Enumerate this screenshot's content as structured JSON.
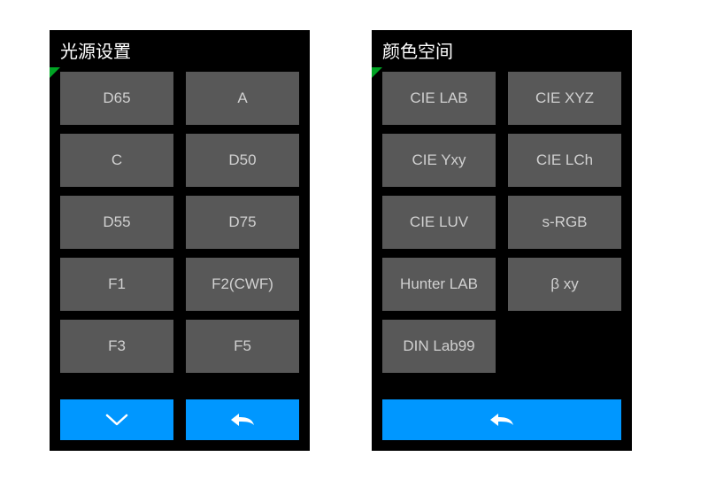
{
  "colors": {
    "accent": "#0097ff",
    "cell_bg": "#585858",
    "panel_bg": "#000000",
    "indicator": "#00a424"
  },
  "panels": {
    "left": {
      "title": "光源设置",
      "items": [
        "D65",
        "A",
        "C",
        "D50",
        "D55",
        "D75",
        "F1",
        "F2(CWF)",
        "F3",
        "F5"
      ],
      "footer": [
        "down",
        "back"
      ]
    },
    "right": {
      "title": "颜色空间",
      "items": [
        "CIE LAB",
        "CIE XYZ",
        "CIE Yxy",
        "CIE LCh",
        "CIE LUV",
        "s-RGB",
        "Hunter LAB",
        "β xy",
        "DIN Lab99"
      ],
      "footer": [
        "back"
      ]
    }
  }
}
